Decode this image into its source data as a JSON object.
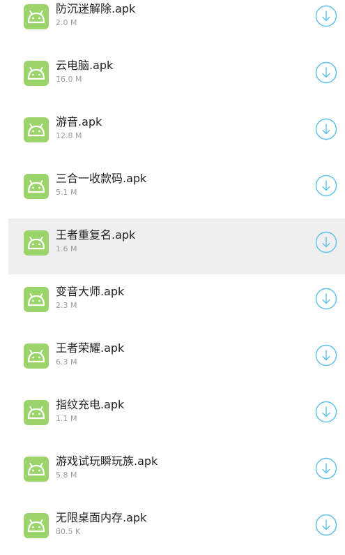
{
  "files": [
    {
      "name": "防沉迷解除.apk",
      "size": "2.0 M",
      "icon": "android-icon",
      "action_icon": "download-icon"
    },
    {
      "name": "云电脑.apk",
      "size": "16.0 M",
      "icon": "android-icon",
      "action_icon": "download-icon"
    },
    {
      "name": "游音.apk",
      "size": "12.8 M",
      "icon": "android-icon",
      "action_icon": "download-icon"
    },
    {
      "name": "三合一收款码.apk",
      "size": "5.1 M",
      "icon": "android-icon",
      "action_icon": "download-icon"
    },
    {
      "name": "王者重复名.apk",
      "size": "1.6 M",
      "icon": "android-icon",
      "action_icon": "download-icon",
      "highlighted": true
    },
    {
      "name": "变音大师.apk",
      "size": "2.3 M",
      "icon": "android-icon",
      "action_icon": "download-icon"
    },
    {
      "name": "王者荣耀.apk",
      "size": "6.3 M",
      "icon": "android-icon",
      "action_icon": "download-icon"
    },
    {
      "name": "指纹充电.apk",
      "size": "1.1 M",
      "icon": "android-icon",
      "action_icon": "download-icon"
    },
    {
      "name": "游戏试玩瞬玩族.apk",
      "size": "5.8 M",
      "icon": "android-icon",
      "action_icon": "download-icon"
    },
    {
      "name": "无限桌面内存.apk",
      "size": "80.5 K",
      "icon": "android-icon",
      "action_icon": "download-icon"
    }
  ],
  "colors": {
    "icon_bg": "#9bd46a",
    "accent": "#5bc0ec",
    "highlight_bg": "#efefef",
    "title_text": "#222222",
    "size_text": "#9b9b9b"
  }
}
